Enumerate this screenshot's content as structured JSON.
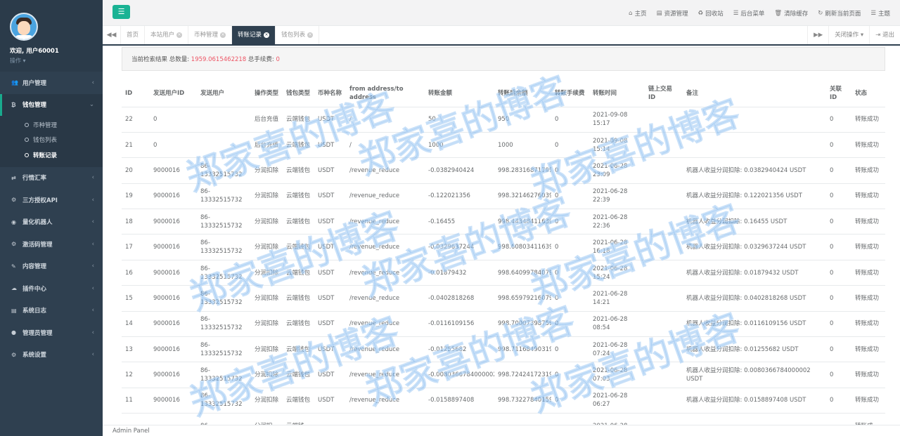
{
  "sidebar": {
    "welcome": "欢迎, 用户60001",
    "ops": "操作 ▾",
    "menu": [
      {
        "label": "用户管理",
        "icon": "users-icon"
      },
      {
        "label": "钱包管理",
        "icon": "bitcoin-icon"
      },
      {
        "label": "行情汇率",
        "icon": "exchange-icon"
      },
      {
        "label": "三方授权API",
        "icon": "settings-icon"
      },
      {
        "label": "量化机器人",
        "icon": "robot-icon"
      },
      {
        "label": "激活码管理",
        "icon": "key-icon"
      },
      {
        "label": "内容管理",
        "icon": "edit-icon"
      },
      {
        "label": "插件中心",
        "icon": "plugin-icon"
      },
      {
        "label": "系统日志",
        "icon": "log-icon"
      },
      {
        "label": "管理员管理",
        "icon": "user-icon"
      },
      {
        "label": "系统设置",
        "icon": "cogs-icon"
      }
    ],
    "submenu": [
      "币种管理",
      "钱包列表",
      "转账记录"
    ]
  },
  "topnav": {
    "links": [
      "主页",
      "资源管理",
      "回收站",
      "后台菜单",
      "清除缓存",
      "刷新当前页面",
      "主题"
    ]
  },
  "tabs": {
    "items": [
      "首页",
      "本站用户",
      "币种管理",
      "转账记录",
      "钱包列表"
    ],
    "active_index": 3,
    "close_ops": "关闭操作 ▾",
    "exit": "退出"
  },
  "summary": {
    "prefix": "当前检索结果 总数量:",
    "total": "1959.0615462218",
    "fee_label": "总手续费:",
    "fee": "0"
  },
  "table": {
    "headers": [
      "ID",
      "发送用户ID",
      "发送用户",
      "操作类型",
      "钱包类型",
      "币种名称",
      "from address/to address",
      "转账金额",
      "转账后余额",
      "转账手续费",
      "转账时间",
      "链上交易ID",
      "备注",
      "关联ID",
      "状态"
    ],
    "rows": [
      [
        "22",
        "0",
        "",
        "后台充值",
        "云端钱包",
        "USDT",
        "/",
        "50",
        "950",
        "0",
        "2021-09-08 15:17",
        "",
        "",
        "0",
        "转账成功"
      ],
      [
        "21",
        "0",
        "",
        "后台充值",
        "云端钱包",
        "USDT",
        "/",
        "1000",
        "1000",
        "0",
        "2021-09-08 15:14",
        "",
        "",
        "0",
        "转账成功"
      ],
      [
        "20",
        "9000016",
        "86-13332515732",
        "分润扣除",
        "云端钱包",
        "USDT",
        "/revenue_reduce",
        "-0.0382940424",
        "998.28316871799",
        "0",
        "2021-06-28 23:09",
        "",
        "机器人收益分润扣除: 0.0382940424 USDT",
        "0",
        "转账成功"
      ],
      [
        "19",
        "9000016",
        "86-13332515732",
        "分润扣除",
        "云端钱包",
        "USDT",
        "/revenue_reduce",
        "-0.122021356",
        "998.32146276039",
        "0",
        "2021-06-28 22:39",
        "",
        "机器人收益分润扣除: 0.122021356 USDT",
        "0",
        "转账成功"
      ],
      [
        "18",
        "9000016",
        "86-13332515732",
        "分润扣除",
        "云端钱包",
        "USDT",
        "/revenue_reduce",
        "-0.16455",
        "998.44348411639",
        "0",
        "2021-06-28 22:36",
        "",
        "机器人收益分润扣除: 0.16455 USDT",
        "0",
        "转账成功"
      ],
      [
        "17",
        "9000016",
        "86-13332515732",
        "分润扣除",
        "云端钱包",
        "USDT",
        "/revenue_reduce",
        "-0.0329637244",
        "998.60803411639",
        "0",
        "2021-06-28 16:18",
        "",
        "机器人收益分润扣除: 0.0329637244 USDT",
        "0",
        "转账成功"
      ],
      [
        "16",
        "9000016",
        "86-13332515732",
        "分润扣除",
        "云端钱包",
        "USDT",
        "/revenue_reduce",
        "-0.01879432",
        "998.64099784079",
        "0",
        "2021-06-28 15:24",
        "",
        "机器人收益分润扣除: 0.01879432 USDT",
        "0",
        "转账成功"
      ],
      [
        "15",
        "9000016",
        "86-13332515732",
        "分润扣除",
        "云端钱包",
        "USDT",
        "/revenue_reduce",
        "-0.0402818268",
        "998.65979216079",
        "0",
        "2021-06-28 14:21",
        "",
        "机器人收益分润扣除: 0.0402818268 USDT",
        "0",
        "转账成功"
      ],
      [
        "14",
        "9000016",
        "86-13332515732",
        "分润扣除",
        "云端钱包",
        "USDT",
        "/revenue_reduce",
        "-0.0116109156",
        "998.70007398759",
        "0",
        "2021-06-28 08:54",
        "",
        "机器人收益分润扣除: 0.0116109156 USDT",
        "0",
        "转账成功"
      ],
      [
        "13",
        "9000016",
        "86-13332515732",
        "分润扣除",
        "云端钱包",
        "USDT",
        "/revenue_reduce",
        "-0.01255682",
        "998.71168490319",
        "0",
        "2021-06-28 07:24",
        "",
        "机器人收益分润扣除: 0.01255682 USDT",
        "0",
        "转账成功"
      ],
      [
        "12",
        "9000016",
        "86-13332515732",
        "分润扣除",
        "云端钱包",
        "USDT",
        "/revenue_reduce",
        "-0.0080366784000002",
        "998.72424172319",
        "0",
        "2021-06-28 07:03",
        "",
        "机器人收益分润扣除: 0.0080366784000002 USDT",
        "0",
        "转账成功"
      ],
      [
        "11",
        "9000016",
        "86-13332515732",
        "分润扣除",
        "云端钱包",
        "USDT",
        "/revenue_reduce",
        "-0.0158897408",
        "998.73227840159",
        "0",
        "2021-06-28 06:27",
        "",
        "机器人收益分润扣除: 0.0158897408 USDT",
        "0",
        "转账成功"
      ],
      [
        "",
        "",
        "86-",
        "分润扣",
        "云端钱",
        "",
        "",
        "",
        "",
        "",
        "2021-06-28",
        "",
        "",
        "",
        "转账成"
      ]
    ]
  },
  "watermark": "郑家喜的博客",
  "footer": "Admin Panel",
  "colors": {
    "sidebar": "#2f4050",
    "accent": "#1ab394",
    "red": "#ed5565",
    "watermark": "#4596e8"
  }
}
